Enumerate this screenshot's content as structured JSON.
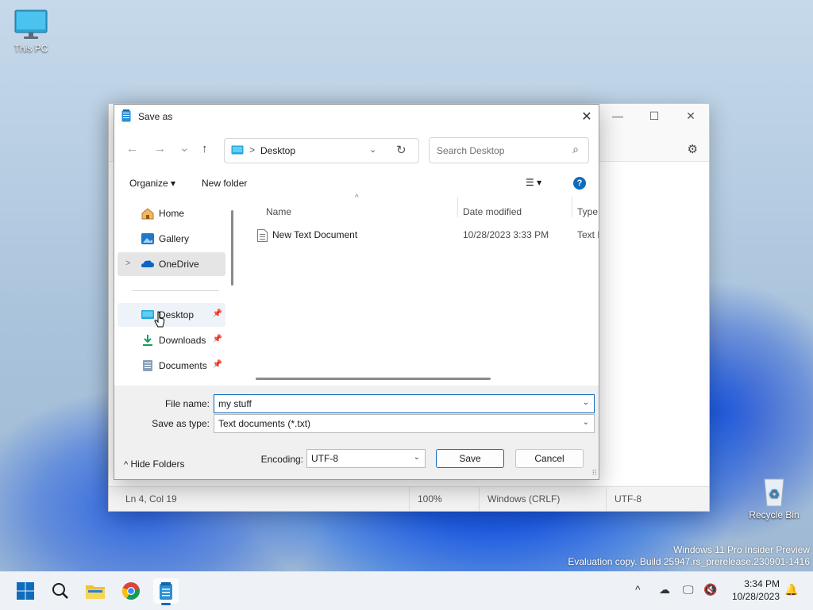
{
  "desktop": {
    "this_pc_label": "This PC",
    "recycle_bin_label": "Recycle Bin",
    "watermark_line1": "Windows 11 Pro Insider Preview",
    "watermark_line2": "Evaluation copy. Build 25947.rs_prerelease.230901-1416"
  },
  "notepad": {
    "status_position": "Ln 4, Col 19",
    "status_zoom": "100%",
    "status_line_ending": "Windows (CRLF)",
    "status_encoding": "UTF-8",
    "minimize_glyph": "—",
    "maximize_glyph": "☐",
    "close_glyph": "✕",
    "settings_icon": "gear-icon"
  },
  "dialog": {
    "title": "Save as",
    "close_glyph": "✕",
    "nav": {
      "back": "←",
      "forward": "→",
      "recent": "⌄",
      "up": "↑"
    },
    "address": {
      "separator": ">",
      "crumb": "Desktop",
      "dropdown": "⌄",
      "refresh": "↻"
    },
    "search": {
      "placeholder": "Search Desktop",
      "icon": "⌕"
    },
    "toolbar": {
      "organize_label": "Organize ▾",
      "new_folder_label": "New folder",
      "view_glyph": "☰ ▾",
      "help_glyph": "?"
    },
    "nav_pane": {
      "items": [
        {
          "label": "Home",
          "icon": "home-icon"
        },
        {
          "label": "Gallery",
          "icon": "gallery-icon"
        },
        {
          "label": "OneDrive",
          "icon": "onedrive-icon",
          "expander": ">"
        },
        {
          "label": "Desktop",
          "icon": "desktop-icon",
          "pin": "📌"
        },
        {
          "label": "Downloads",
          "icon": "downloads-icon",
          "pin": "📌"
        },
        {
          "label": "Documents",
          "icon": "documents-icon",
          "pin": "📌"
        }
      ]
    },
    "columns": {
      "name": "Name",
      "date_modified": "Date modified",
      "type": "Type",
      "sort_glyph": "^"
    },
    "files": [
      {
        "name": "New Text Document",
        "date_modified": "10/28/2023 3:33 PM",
        "type": "Text D"
      }
    ],
    "form": {
      "file_name_label": "File name:",
      "file_name_value": "my stuff",
      "save_type_label": "Save as type:",
      "save_type_value": "Text documents (*.txt)",
      "encoding_label": "Encoding:",
      "encoding_value": "UTF-8",
      "arrow_glyph": "⌄",
      "save_label": "Save",
      "cancel_label": "Cancel",
      "hide_folders_label": "Hide Folders",
      "hide_folders_glyph": "^",
      "grip_glyph": "⠿"
    }
  },
  "taskbar": {
    "time": "3:34 PM",
    "date": "10/28/2023",
    "chevron_glyph": "^",
    "accent_color": "#0f6cbd"
  }
}
